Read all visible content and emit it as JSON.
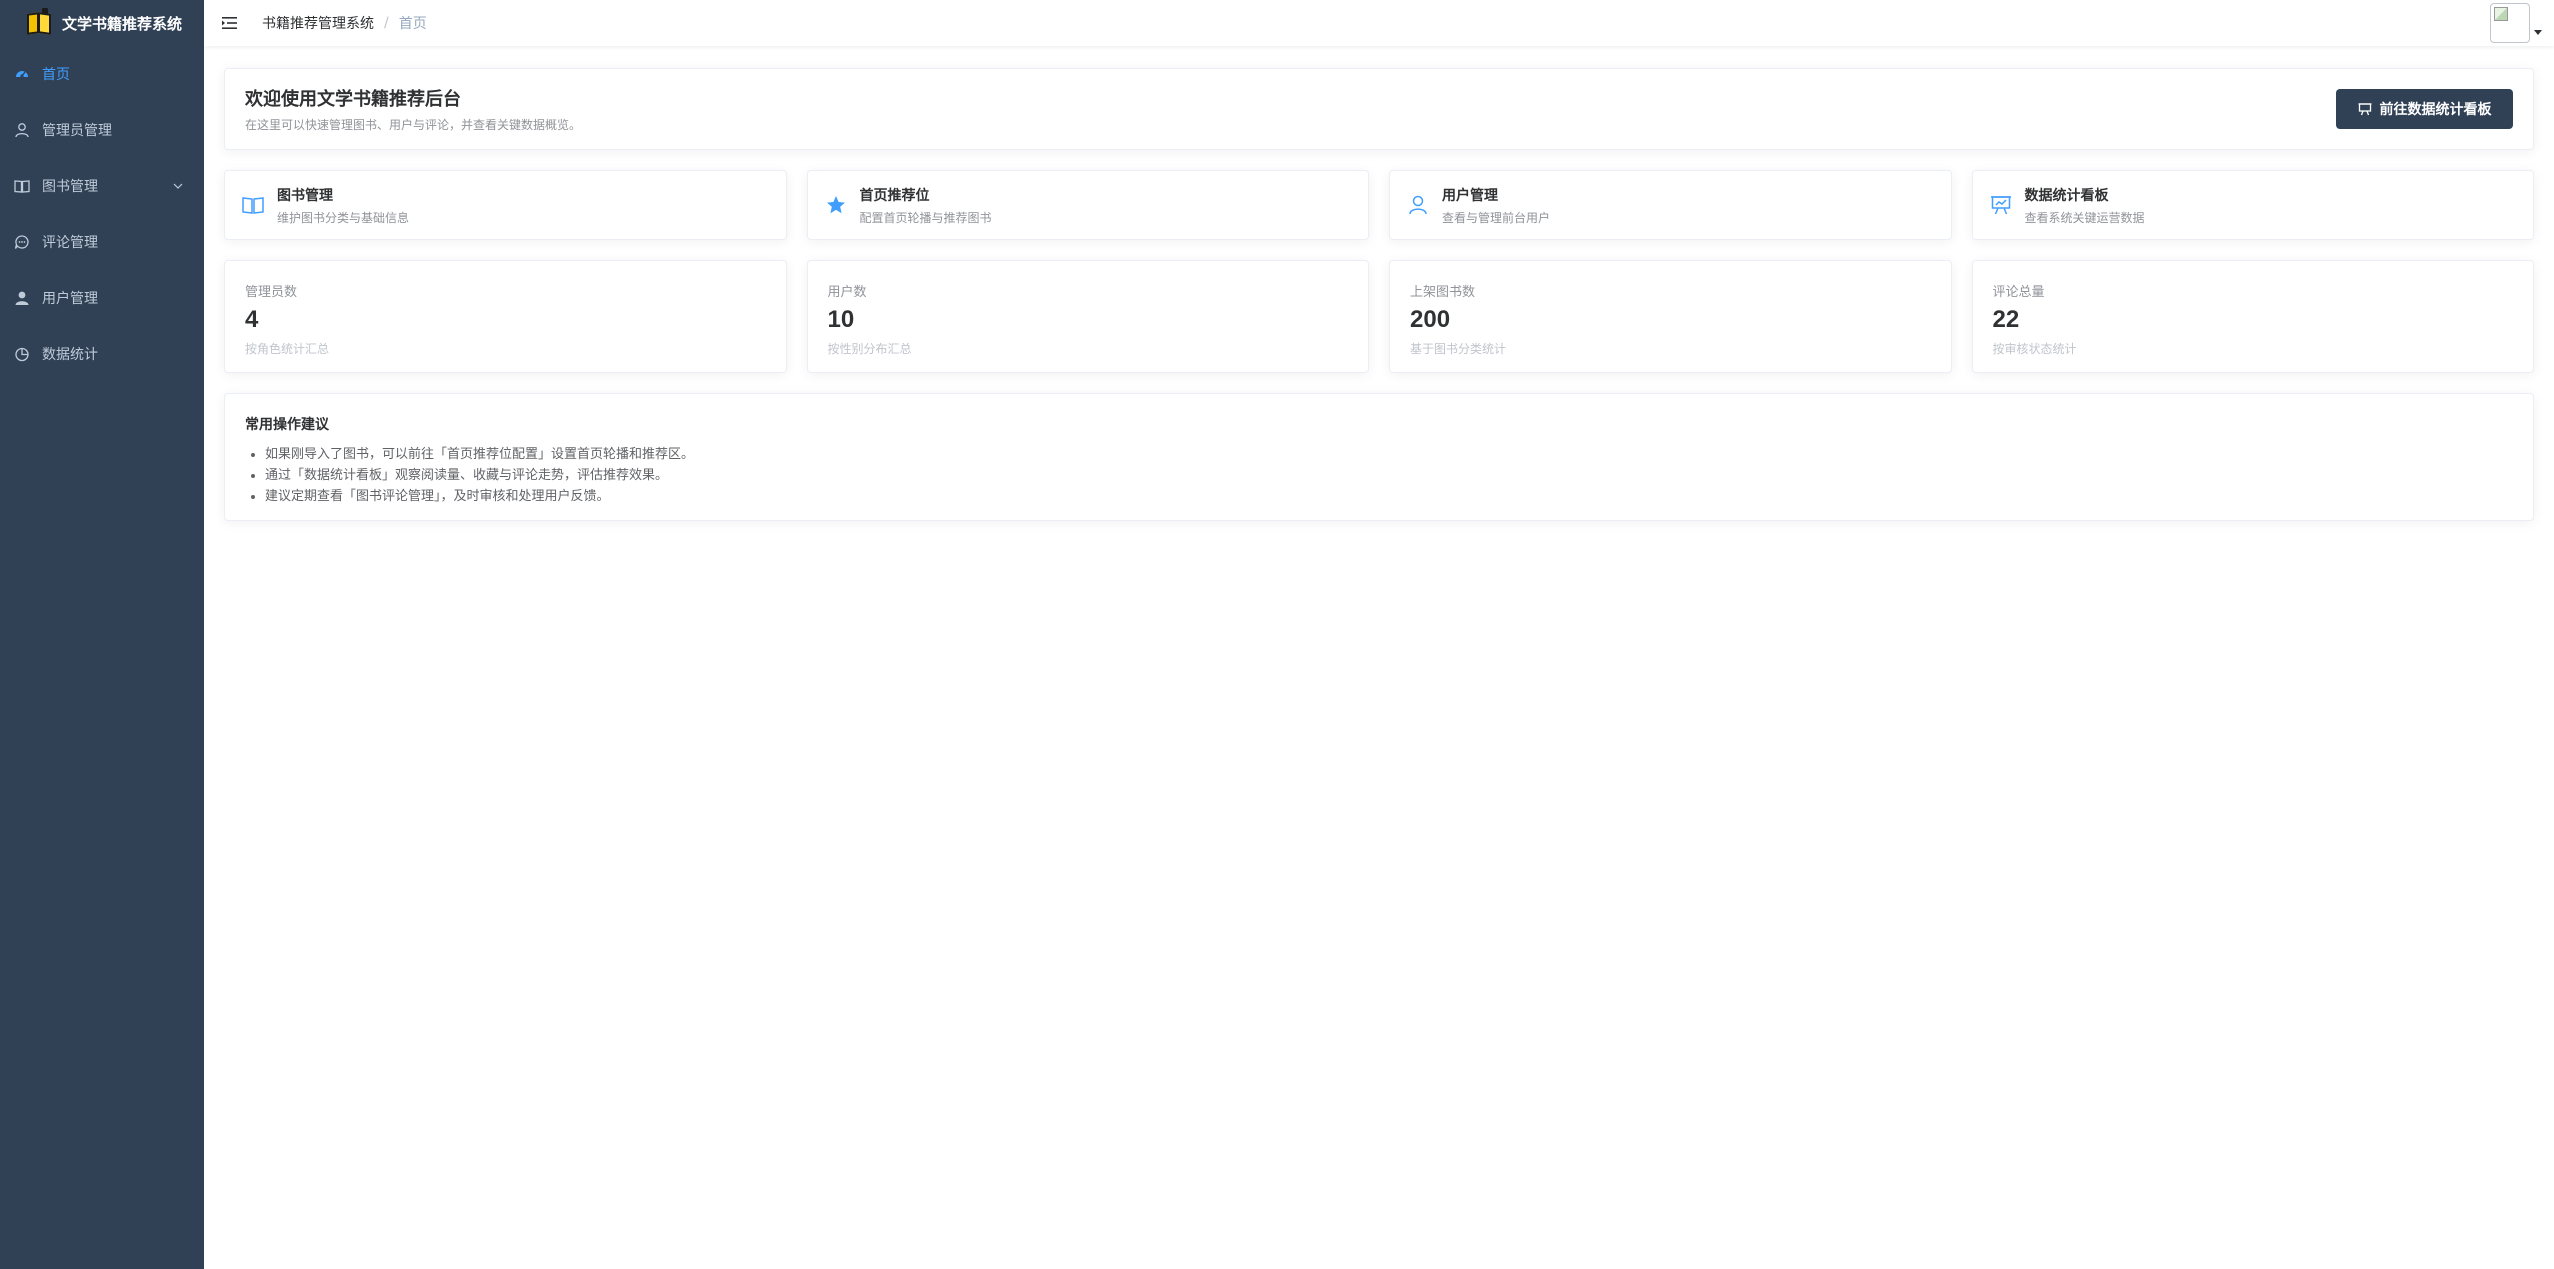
{
  "app": {
    "title": "文学书籍推荐系统"
  },
  "sidebar": {
    "items": [
      {
        "label": "首页",
        "icon": "dashboard-icon",
        "active": true
      },
      {
        "label": "管理员管理",
        "icon": "user-outline-icon"
      },
      {
        "label": "图书管理",
        "icon": "book-icon",
        "has_children": true
      },
      {
        "label": "评论管理",
        "icon": "chat-icon"
      },
      {
        "label": "用户管理",
        "icon": "user-solid-icon"
      },
      {
        "label": "数据统计",
        "icon": "pie-chart-icon"
      }
    ]
  },
  "header": {
    "breadcrumb": [
      "书籍推荐管理系统",
      "首页"
    ],
    "separator": "/"
  },
  "welcome": {
    "title": "欢迎使用文学书籍推荐后台",
    "subtitle": "在这里可以快速管理图书、用户与评论，并查看关键数据概览。",
    "button_label": "前往数据统计看板"
  },
  "quick_links": [
    {
      "title": "图书管理",
      "desc": "维护图书分类与基础信息",
      "icon": "book-open-icon"
    },
    {
      "title": "首页推荐位",
      "desc": "配置首页轮播与推荐图书",
      "icon": "star-icon"
    },
    {
      "title": "用户管理",
      "desc": "查看与管理前台用户",
      "icon": "user-icon"
    },
    {
      "title": "数据统计看板",
      "desc": "查看系统关键运营数据",
      "icon": "presentation-board-icon"
    }
  ],
  "stats": [
    {
      "label": "管理员数",
      "value": "4",
      "note": "按角色统计汇总"
    },
    {
      "label": "用户数",
      "value": "10",
      "note": "按性别分布汇总"
    },
    {
      "label": "上架图书数",
      "value": "200",
      "note": "基于图书分类统计"
    },
    {
      "label": "评论总量",
      "value": "22",
      "note": "按审核状态统计"
    }
  ],
  "tips": {
    "title": "常用操作建议",
    "items": [
      "如果刚导入了图书，可以前往「首页推荐位配置」设置首页轮播和推荐区。",
      "通过「数据统计看板」观察阅读量、收藏与评论走势，评估推荐效果。",
      "建议定期查看「图书评论管理」，及时审核和处理用户反馈。"
    ]
  },
  "colors": {
    "sidebar_bg": "#304156",
    "sidebar_text": "#bfcbd9",
    "active": "#409eff",
    "button_bg": "#304156"
  }
}
